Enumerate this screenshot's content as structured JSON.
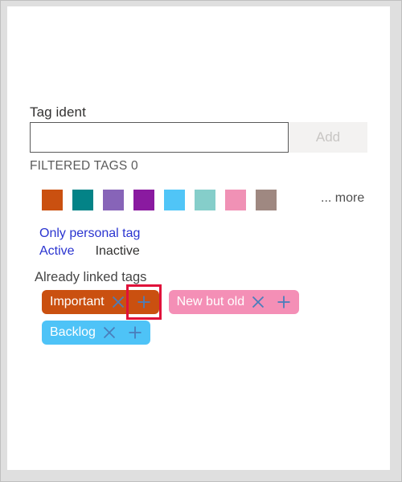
{
  "form": {
    "label": "Tag ident",
    "input_value": "",
    "input_placeholder": "",
    "add_label": "Add"
  },
  "filtered_tags_text": "FILTERED TAGS 0",
  "palette": {
    "more_label": "... more",
    "swatches": [
      {
        "name": "burnt-orange",
        "color": "#ca5010"
      },
      {
        "name": "teal",
        "color": "#038387"
      },
      {
        "name": "purple",
        "color": "#8764b8"
      },
      {
        "name": "magenta",
        "color": "#8a1aa0"
      },
      {
        "name": "sky-blue",
        "color": "#50c5f7"
      },
      {
        "name": "mint",
        "color": "#85ceca"
      },
      {
        "name": "pink",
        "color": "#f091b5"
      },
      {
        "name": "taupe",
        "color": "#9f8881"
      }
    ]
  },
  "filters": {
    "personal_label": "Only personal tag",
    "active_label": "Active",
    "inactive_label": "Inactive"
  },
  "linked": {
    "heading": "Already linked tags",
    "rows": [
      [
        {
          "label": "Important",
          "color": "#ca5010",
          "highlight_add": true
        },
        {
          "label": "New but old",
          "color": "#f48fb6",
          "highlight_add": false
        }
      ],
      [
        {
          "label": "Backlog",
          "color": "#4ec3f7",
          "highlight_add": false
        }
      ]
    ],
    "remove_icon": "close-icon",
    "add_icon": "plus-icon",
    "icon_color": "#4a7ebb"
  }
}
